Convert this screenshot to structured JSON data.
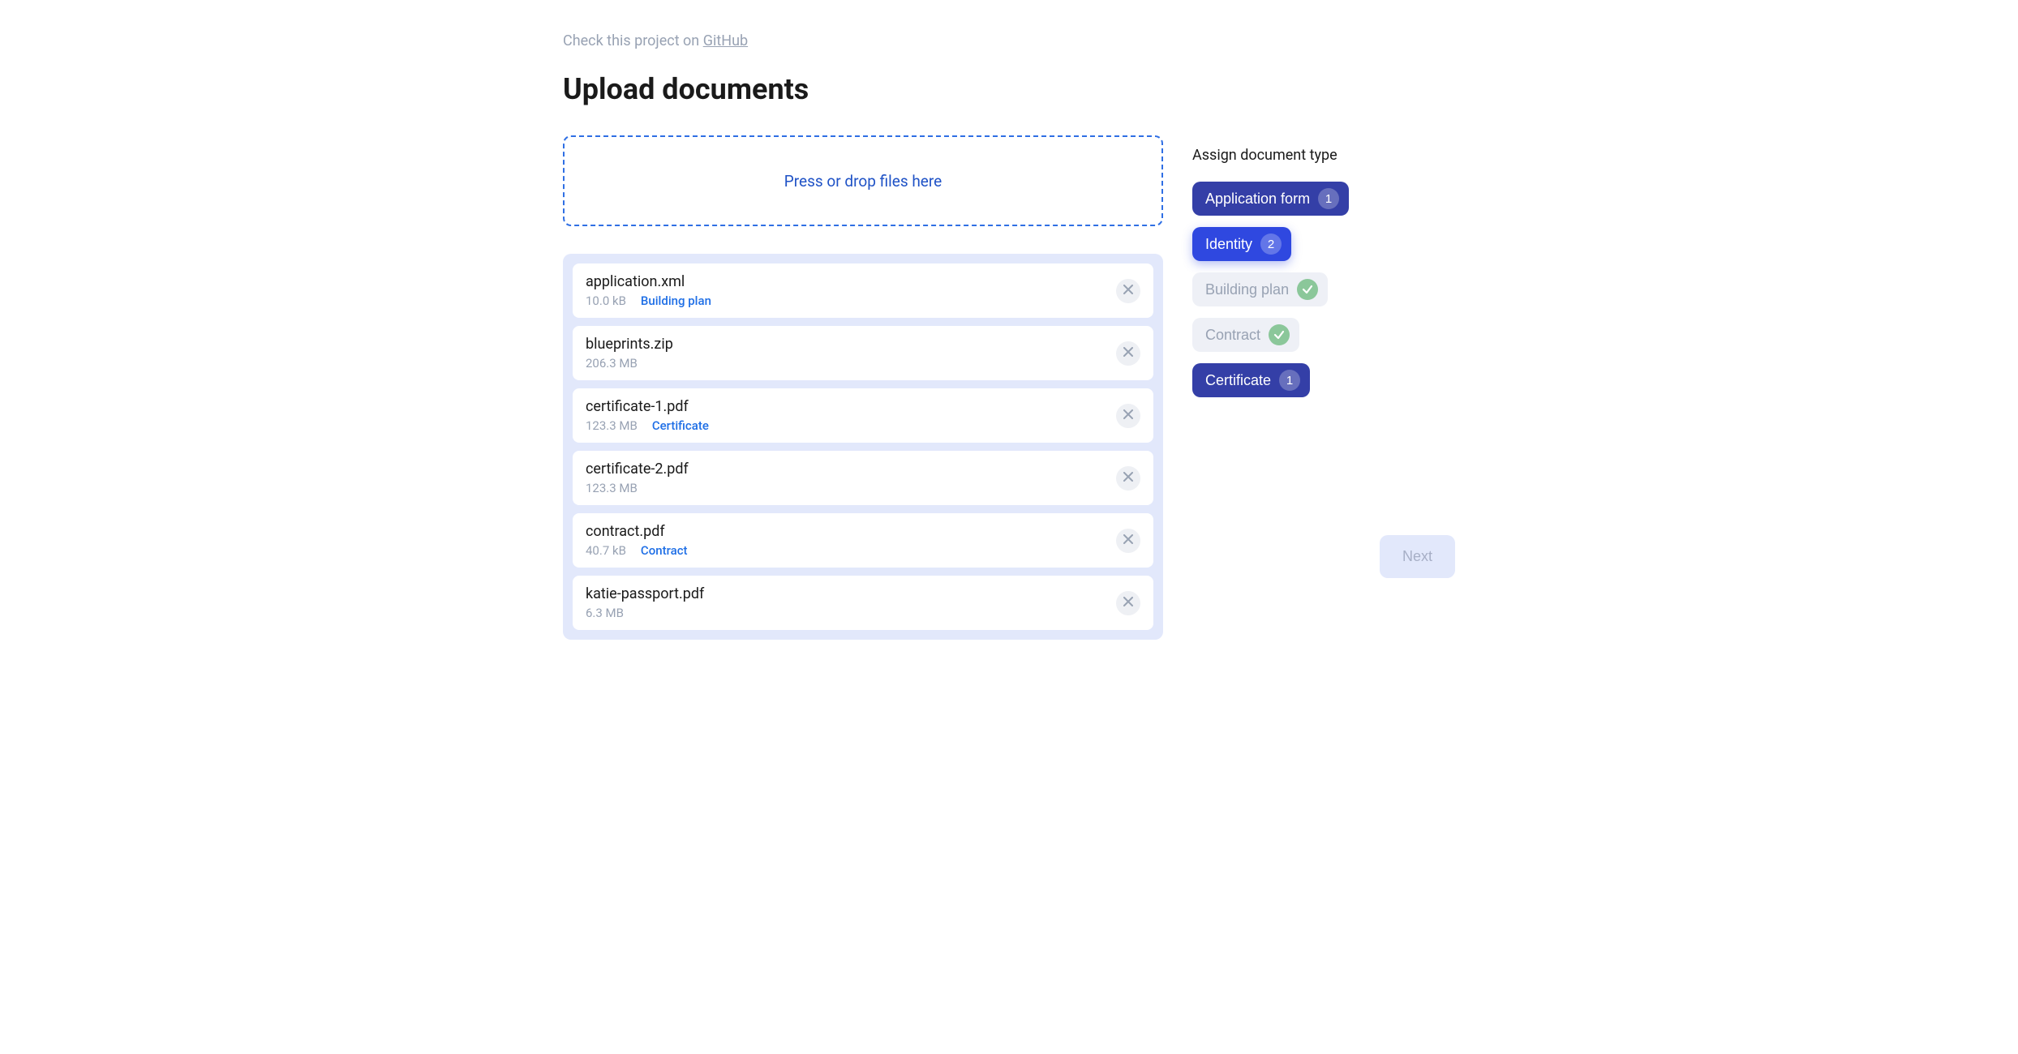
{
  "github": {
    "prefix": "Check this project on ",
    "link_text": "GitHub"
  },
  "title": "Upload documents",
  "dropzone": {
    "text": "Press or drop files here"
  },
  "files": [
    {
      "name": "application.xml",
      "size": "10.0 kB",
      "tag": "Building plan"
    },
    {
      "name": "blueprints.zip",
      "size": "206.3 MB",
      "tag": ""
    },
    {
      "name": "certificate-1.pdf",
      "size": "123.3 MB",
      "tag": "Certificate"
    },
    {
      "name": "certificate-2.pdf",
      "size": "123.3 MB",
      "tag": ""
    },
    {
      "name": "contract.pdf",
      "size": "40.7 kB",
      "tag": "Contract"
    },
    {
      "name": "katie-passport.pdf",
      "size": "6.3 MB",
      "tag": ""
    }
  ],
  "assign": {
    "label": "Assign document type",
    "types": [
      {
        "label": "Application form",
        "count": "1",
        "state": "blue"
      },
      {
        "label": "Identity",
        "count": "2",
        "state": "blue-active"
      },
      {
        "label": "Building plan",
        "count": "check",
        "state": "gray"
      },
      {
        "label": "Contract",
        "count": "check",
        "state": "gray"
      },
      {
        "label": "Certificate",
        "count": "1",
        "state": "blue"
      }
    ]
  },
  "next_label": "Next"
}
